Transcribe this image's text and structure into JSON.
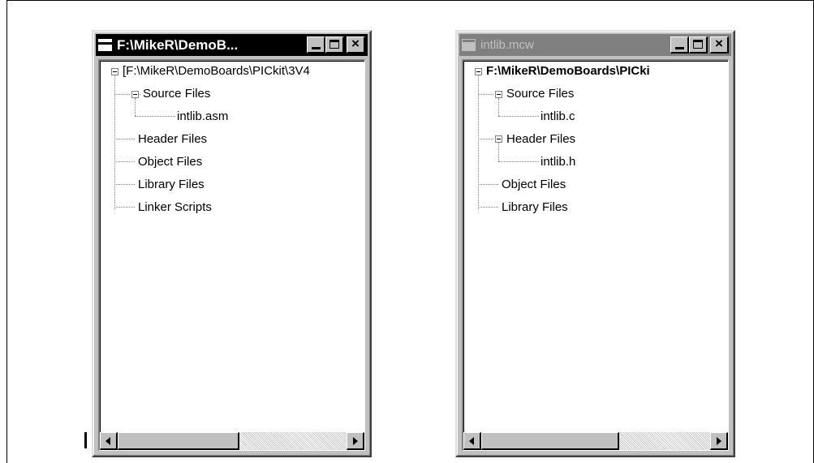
{
  "window1": {
    "title": "F:\\MikeR\\DemoB...",
    "tree": {
      "root": "[F:\\MikeR\\DemoBoards\\PICkit\\3V4",
      "source_files": "Source Files",
      "source_child": "intlib.asm",
      "header_files": "Header Files",
      "object_files": "Object Files",
      "library_files": "Library Files",
      "linker_scripts": "Linker Scripts"
    },
    "scroll_position": 0.0
  },
  "window2": {
    "title": "intlib.mcw",
    "tree": {
      "root": "F:\\MikeR\\DemoBoards\\PICki",
      "source_files": "Source Files",
      "source_child": "intlib.c",
      "header_files": "Header Files",
      "header_child": "intlib.h",
      "object_files": "Object Files",
      "library_files": "Library Files"
    },
    "scroll_position": 0.0
  },
  "buttons": {
    "close": "×"
  },
  "colors": {
    "active_title": "#000000",
    "inactive_title": "#808080",
    "chrome": "#c0c0c0"
  }
}
